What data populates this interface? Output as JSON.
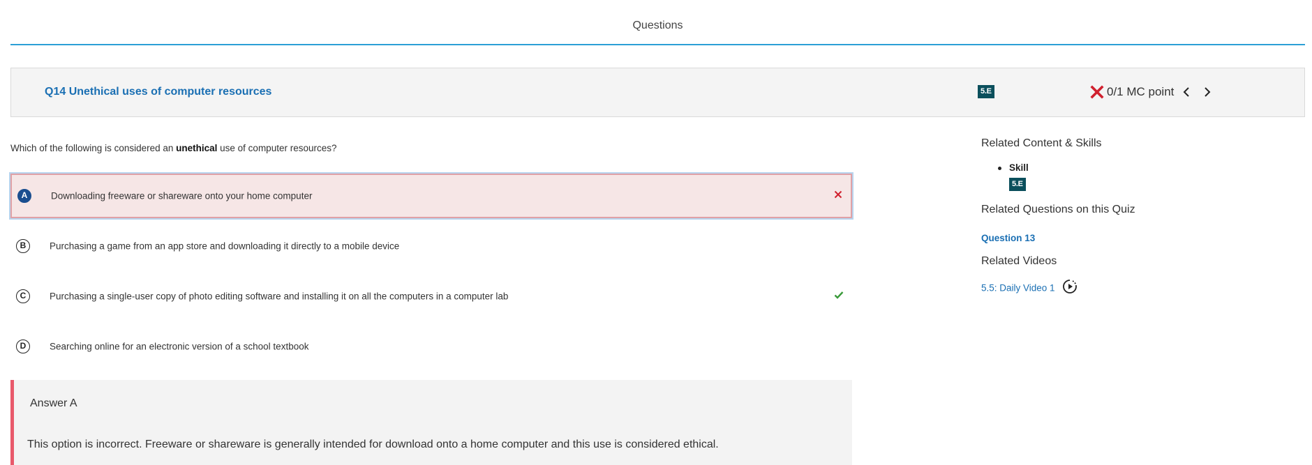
{
  "tab": {
    "label": "Questions"
  },
  "question": {
    "title": "Q14 Unethical uses of computer resources",
    "skill_badge": "5.E",
    "score": "0/1 MC point",
    "prompt_before": "Which of the following is considered an ",
    "prompt_bold": "unethical",
    "prompt_after": " use of computer resources?"
  },
  "options": [
    {
      "letter": "A",
      "text": "Downloading freeware or shareware onto your home computer",
      "selected": true,
      "mark": "x-icon"
    },
    {
      "letter": "B",
      "text": "Purchasing a game from an app store and downloading it directly to a mobile device",
      "selected": false,
      "mark": ""
    },
    {
      "letter": "C",
      "text": "Purchasing a single-user copy of photo editing software and installing it on all the computers in a computer lab",
      "selected": false,
      "mark": "check-icon"
    },
    {
      "letter": "D",
      "text": "Searching online for an electronic version of a school textbook",
      "selected": false,
      "mark": ""
    }
  ],
  "answer": {
    "title": "Answer A",
    "text": "This option is incorrect. Freeware or shareware is generally intended for download onto a home computer and this use is considered ethical."
  },
  "sidebar": {
    "related_content_heading": "Related Content & Skills",
    "skill_label": "Skill",
    "skill_badge": "5.E",
    "related_questions_heading": "Related Questions on this Quiz",
    "related_question_link": "Question 13",
    "related_videos_heading": "Related Videos",
    "video_link": "5.5: Daily Video 1"
  },
  "colors": {
    "accent_blue": "#1a6fb3",
    "tab_underline": "#2b9fd6",
    "wrong_red": "#d0202e",
    "correct_green": "#3a9a3a",
    "badge_teal": "#0b4f5c"
  }
}
